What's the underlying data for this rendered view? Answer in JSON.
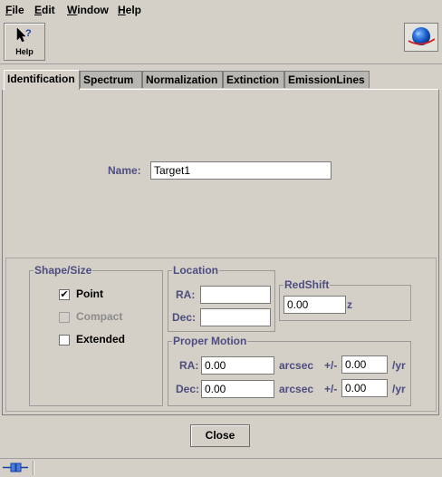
{
  "menubar": {
    "items": [
      {
        "label": "File",
        "mnemonic": "F",
        "rest": "ile"
      },
      {
        "label": "Edit",
        "mnemonic": "E",
        "rest": "dit"
      },
      {
        "label": "Window",
        "mnemonic": "W",
        "rest": "indow"
      },
      {
        "label": "Help",
        "mnemonic": "H",
        "rest": "elp"
      }
    ]
  },
  "toolbar": {
    "help_label": "Help",
    "help_icon": "help-cursor-icon",
    "globe_icon": "globe-icon"
  },
  "tabs": [
    {
      "label": "Identification",
      "active": true
    },
    {
      "label": "Spectrum",
      "active": false
    },
    {
      "label": "Normalization",
      "active": false
    },
    {
      "label": "Extinction",
      "active": false
    },
    {
      "label": "EmissionLines",
      "active": false
    }
  ],
  "identification": {
    "name_label": "Name:",
    "name_value": "Target1"
  },
  "shape_size": {
    "title": "Shape/Size",
    "options": [
      {
        "label": "Point",
        "checked": true,
        "enabled": true
      },
      {
        "label": "Compact",
        "checked": false,
        "enabled": false
      },
      {
        "label": "Extended",
        "checked": false,
        "enabled": true
      }
    ]
  },
  "location": {
    "title": "Location",
    "ra_label": "RA:",
    "ra_value": "",
    "dec_label": "Dec:",
    "dec_value": ""
  },
  "redshift": {
    "title": "RedShift",
    "value": "0.00",
    "unit": "z"
  },
  "proper_motion": {
    "title": "Proper Motion",
    "ra_label": "RA:",
    "ra_value": "0.00",
    "ra_unit": "arcsec",
    "ra_pm": "+/-",
    "ra_err": "0.00",
    "ra_rate": "/yr",
    "dec_label": "Dec:",
    "dec_value": "0.00",
    "dec_unit": "arcsec",
    "dec_pm": "+/-",
    "dec_err": "0.00",
    "dec_rate": "/yr"
  },
  "footer": {
    "close_label": "Close"
  },
  "colors": {
    "background": "#d4d0c8",
    "label_blue": "#4d4d80",
    "globe_blue": "#1a5fd0"
  }
}
